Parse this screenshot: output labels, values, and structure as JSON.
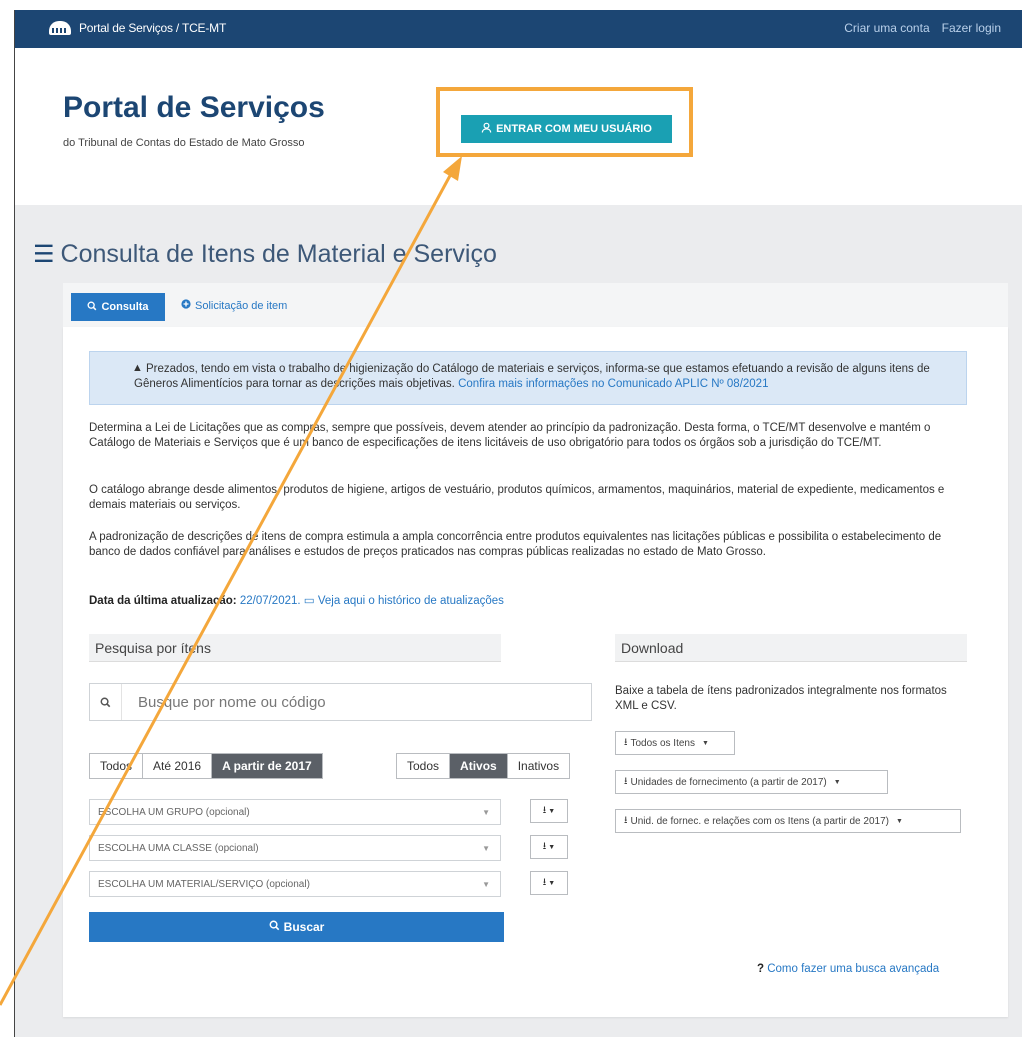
{
  "topbar": {
    "brand": "Portal de Serviços / TCE-MT",
    "create_account": "Criar uma conta",
    "login": "Fazer login"
  },
  "header": {
    "title": "Portal de Serviços",
    "subtitle": "do Tribunal de Contas do Estado de Mato Grosso",
    "enter_button": "ENTRAR COM MEU USUÁRIO"
  },
  "page": {
    "title": "Consulta de Itens de Material e Serviço"
  },
  "tabs": {
    "consulta": "Consulta",
    "solicitacao": "Solicitação de item"
  },
  "alert": {
    "text": "Prezados, tendo em vista o trabalho de higienização do Catálogo de materiais e serviços, informa-se que estamos efetuando a revisão de alguns itens de Gêneros Alimentícios para tornar as descrições mais objetivas.",
    "link": "Confira mais informações no Comunicado APLIC Nº 08/2021"
  },
  "paragraphs": {
    "p1": "Determina a Lei de Licitações que as compras, sempre que possíveis, devem atender ao princípio da padronização. Desta forma, o TCE/MT desenvolve e mantém o Catálogo de Materiais e Serviços que é um banco de especificações de itens licitáveis de uso obrigatório para todos os órgãos sob a jurisdição do TCE/MT.",
    "p2": "O catálogo abrange desde alimentos, produtos de higiene, artigos de vestuário, produtos químicos, armamentos, maquinários, material de expediente, medicamentos e demais materiais ou serviços.",
    "p3": "A padronização de descrições de itens de compra estimula a ampla concorrência entre produtos equivalentes nas licitações públicas e possibilita o estabelecimento de banco de dados confiável para análises e estudos de preços praticados nas compras públicas realizadas no estado de Mato Grosso."
  },
  "update": {
    "label": "Data da última atualização:",
    "date": "22/07/2021.",
    "history_link": "Veja aqui o histórico de atualizações"
  },
  "search_section": {
    "heading": "Pesquisa por ítens",
    "placeholder": "Busque por nome ou código",
    "period": [
      "Todos",
      "Até 2016",
      "A partir de 2017"
    ],
    "status": [
      "Todos",
      "Ativos",
      "Inativos"
    ],
    "group_select": "ESCOLHA UM GRUPO (opcional)",
    "class_select": "ESCOLHA UMA CLASSE (opcional)",
    "material_select": "ESCOLHA UM MATERIAL/SERVIÇO (opcional)",
    "search_button": "Buscar"
  },
  "download_section": {
    "heading": "Download",
    "text": "Baixe a tabela de ítens padronizados integralmente nos formatos XML e CSV.",
    "all_items": "Todos os Itens",
    "supply_units": "Unidades de fornecimento (a partir de 2017)",
    "units_relations": "Unid. de fornec. e relações com os Itens (a partir de 2017)"
  },
  "help": {
    "mark": "?",
    "link": "Como fazer uma busca avançada"
  },
  "colors": {
    "topbar": "#1c4673",
    "primary": "#2778c4",
    "teal_button": "#1aa0b3",
    "highlight": "#f4a73b"
  }
}
